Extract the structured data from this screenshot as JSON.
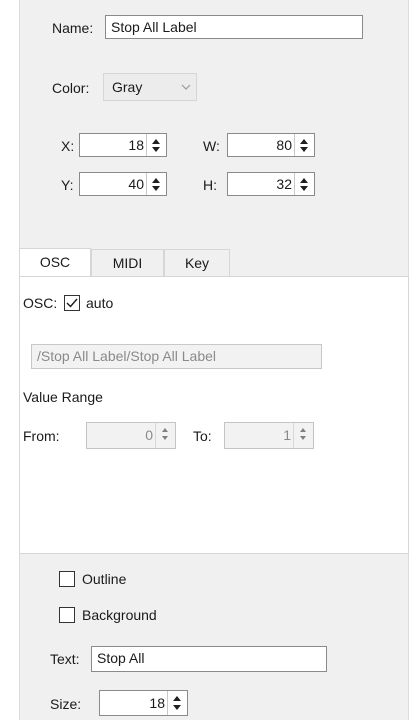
{
  "name_field": {
    "label": "Name:",
    "value": "Stop All Label"
  },
  "color_field": {
    "label": "Color:",
    "value": "Gray"
  },
  "geometry": {
    "x": {
      "label": "X:",
      "value": "18"
    },
    "y": {
      "label": "Y:",
      "value": "40"
    },
    "w": {
      "label": "W:",
      "value": "80"
    },
    "h": {
      "label": "H:",
      "value": "32"
    }
  },
  "tabs": [
    {
      "label": "OSC",
      "active": true
    },
    {
      "label": "MIDI",
      "active": false
    },
    {
      "label": "Key",
      "active": false
    }
  ],
  "osc": {
    "label": "OSC:",
    "auto_label": "auto",
    "auto_checked": true,
    "address": "/Stop All Label/Stop All Label",
    "value_range_label": "Value Range",
    "from_label": "From:",
    "from_value": "0",
    "to_label": "To:",
    "to_value": "1"
  },
  "outline": {
    "label": "Outline",
    "checked": false
  },
  "background": {
    "label": "Background",
    "checked": false
  },
  "text_field": {
    "label": "Text:",
    "value": "Stop All"
  },
  "size_field": {
    "label": "Size:",
    "value": "18"
  },
  "icons": {
    "dropdown": "chevron-down-icon",
    "spin": "spinner-arrows-icon",
    "check": "check-icon"
  }
}
